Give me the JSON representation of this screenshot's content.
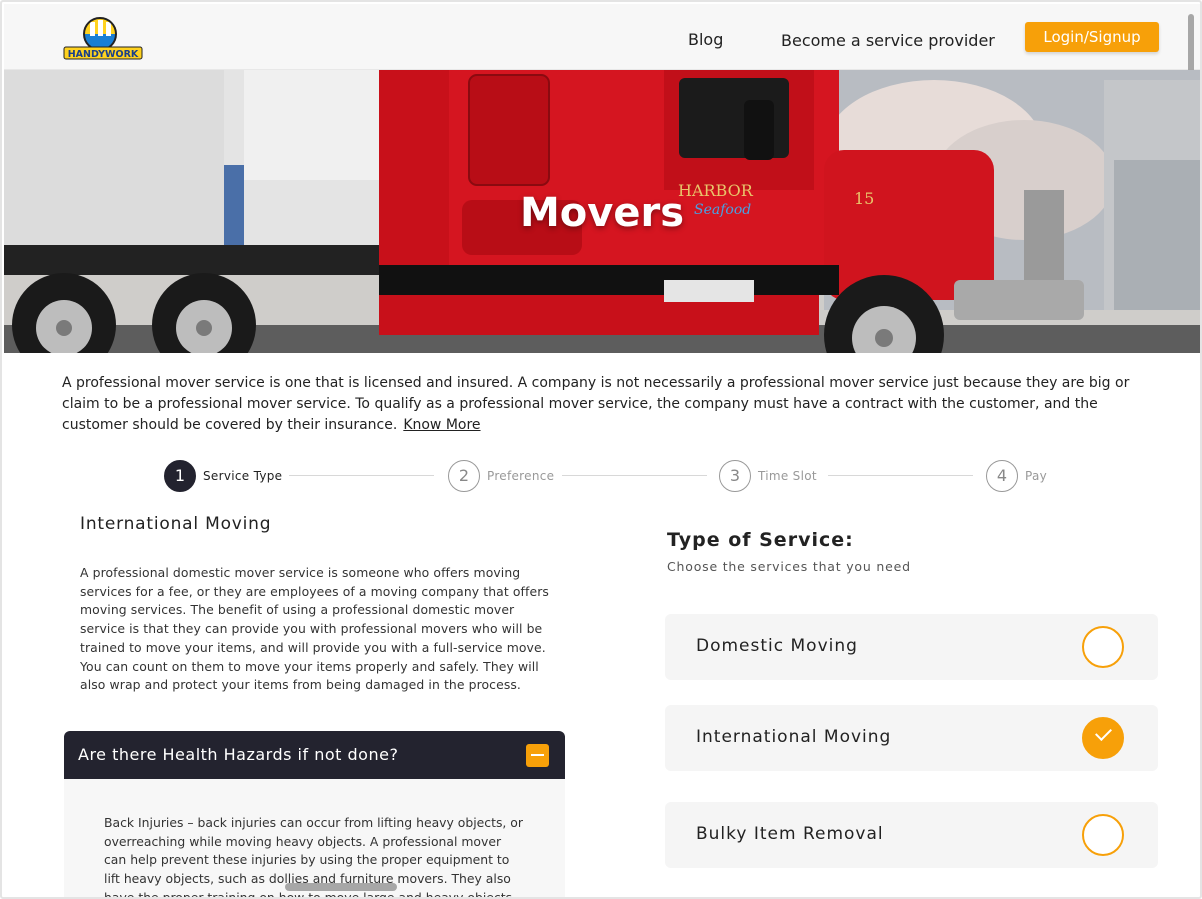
{
  "header": {
    "logo_text": "HANDYWORK",
    "nav_blog": "Blog",
    "nav_provider": "Become a service provider",
    "login_label": "Login/Signup"
  },
  "hero": {
    "title": "Movers",
    "truck_brand_1": "HARBOR",
    "truck_brand_2": "Seafood",
    "truck_number": "15"
  },
  "intro": {
    "text": "A professional mover service is one that is licensed and insured. A company is not necessarily a professional mover service just because they are big or claim to be a professional mover service. To qualify as a professional mover service, the company must have a contract with the customer, and the customer should be covered by their insurance.",
    "link": "Know More"
  },
  "stepper": {
    "steps": [
      {
        "num": "1",
        "label": "Service Type"
      },
      {
        "num": "2",
        "label": "Preference"
      },
      {
        "num": "3",
        "label": "Time Slot"
      },
      {
        "num": "4",
        "label": "Pay"
      }
    ],
    "active_step": 1
  },
  "detail": {
    "title": "International Moving",
    "description": "A professional domestic mover service is someone who offers moving services for a fee, or they are employees of a moving company that offers moving services. The benefit of using a professional domestic mover service is that they can provide you with professional movers who will be trained to move your items, and will provide you with a full-service move. You can count on them to move your items properly and safely. They will also wrap and protect your items from being damaged in the process."
  },
  "faq": {
    "question": "Are there Health Hazards if not done?",
    "answer": "Back Injuries – back injuries can occur from lifting heavy objects, or overreaching while moving heavy objects. A professional mover can help prevent these injuries by using the proper equipment to lift heavy objects, such as dollies and furniture movers. They also have the proper training on how to move large and heavy objects safely."
  },
  "service": {
    "title": "Type of Service:",
    "subtitle": "Choose the services that you need",
    "options": [
      {
        "label": "Domestic Moving",
        "selected": false
      },
      {
        "label": "International Moving",
        "selected": true
      },
      {
        "label": "Bulky Item Removal",
        "selected": false
      }
    ]
  },
  "colors": {
    "accent": "#f7a009",
    "dark": "#23232f"
  }
}
